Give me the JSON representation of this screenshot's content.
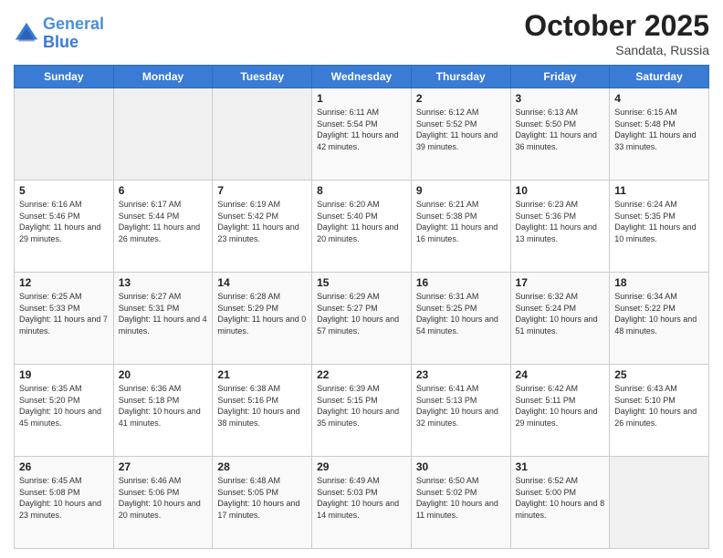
{
  "header": {
    "logo_line1": "General",
    "logo_line2": "Blue",
    "month": "October 2025",
    "location": "Sandata, Russia"
  },
  "weekdays": [
    "Sunday",
    "Monday",
    "Tuesday",
    "Wednesday",
    "Thursday",
    "Friday",
    "Saturday"
  ],
  "weeks": [
    [
      {
        "day": "",
        "sunrise": "",
        "sunset": "",
        "daylight": ""
      },
      {
        "day": "",
        "sunrise": "",
        "sunset": "",
        "daylight": ""
      },
      {
        "day": "",
        "sunrise": "",
        "sunset": "",
        "daylight": ""
      },
      {
        "day": "1",
        "sunrise": "Sunrise: 6:11 AM",
        "sunset": "Sunset: 5:54 PM",
        "daylight": "Daylight: 11 hours and 42 minutes."
      },
      {
        "day": "2",
        "sunrise": "Sunrise: 6:12 AM",
        "sunset": "Sunset: 5:52 PM",
        "daylight": "Daylight: 11 hours and 39 minutes."
      },
      {
        "day": "3",
        "sunrise": "Sunrise: 6:13 AM",
        "sunset": "Sunset: 5:50 PM",
        "daylight": "Daylight: 11 hours and 36 minutes."
      },
      {
        "day": "4",
        "sunrise": "Sunrise: 6:15 AM",
        "sunset": "Sunset: 5:48 PM",
        "daylight": "Daylight: 11 hours and 33 minutes."
      }
    ],
    [
      {
        "day": "5",
        "sunrise": "Sunrise: 6:16 AM",
        "sunset": "Sunset: 5:46 PM",
        "daylight": "Daylight: 11 hours and 29 minutes."
      },
      {
        "day": "6",
        "sunrise": "Sunrise: 6:17 AM",
        "sunset": "Sunset: 5:44 PM",
        "daylight": "Daylight: 11 hours and 26 minutes."
      },
      {
        "day": "7",
        "sunrise": "Sunrise: 6:19 AM",
        "sunset": "Sunset: 5:42 PM",
        "daylight": "Daylight: 11 hours and 23 minutes."
      },
      {
        "day": "8",
        "sunrise": "Sunrise: 6:20 AM",
        "sunset": "Sunset: 5:40 PM",
        "daylight": "Daylight: 11 hours and 20 minutes."
      },
      {
        "day": "9",
        "sunrise": "Sunrise: 6:21 AM",
        "sunset": "Sunset: 5:38 PM",
        "daylight": "Daylight: 11 hours and 16 minutes."
      },
      {
        "day": "10",
        "sunrise": "Sunrise: 6:23 AM",
        "sunset": "Sunset: 5:36 PM",
        "daylight": "Daylight: 11 hours and 13 minutes."
      },
      {
        "day": "11",
        "sunrise": "Sunrise: 6:24 AM",
        "sunset": "Sunset: 5:35 PM",
        "daylight": "Daylight: 11 hours and 10 minutes."
      }
    ],
    [
      {
        "day": "12",
        "sunrise": "Sunrise: 6:25 AM",
        "sunset": "Sunset: 5:33 PM",
        "daylight": "Daylight: 11 hours and 7 minutes."
      },
      {
        "day": "13",
        "sunrise": "Sunrise: 6:27 AM",
        "sunset": "Sunset: 5:31 PM",
        "daylight": "Daylight: 11 hours and 4 minutes."
      },
      {
        "day": "14",
        "sunrise": "Sunrise: 6:28 AM",
        "sunset": "Sunset: 5:29 PM",
        "daylight": "Daylight: 11 hours and 0 minutes."
      },
      {
        "day": "15",
        "sunrise": "Sunrise: 6:29 AM",
        "sunset": "Sunset: 5:27 PM",
        "daylight": "Daylight: 10 hours and 57 minutes."
      },
      {
        "day": "16",
        "sunrise": "Sunrise: 6:31 AM",
        "sunset": "Sunset: 5:25 PM",
        "daylight": "Daylight: 10 hours and 54 minutes."
      },
      {
        "day": "17",
        "sunrise": "Sunrise: 6:32 AM",
        "sunset": "Sunset: 5:24 PM",
        "daylight": "Daylight: 10 hours and 51 minutes."
      },
      {
        "day": "18",
        "sunrise": "Sunrise: 6:34 AM",
        "sunset": "Sunset: 5:22 PM",
        "daylight": "Daylight: 10 hours and 48 minutes."
      }
    ],
    [
      {
        "day": "19",
        "sunrise": "Sunrise: 6:35 AM",
        "sunset": "Sunset: 5:20 PM",
        "daylight": "Daylight: 10 hours and 45 minutes."
      },
      {
        "day": "20",
        "sunrise": "Sunrise: 6:36 AM",
        "sunset": "Sunset: 5:18 PM",
        "daylight": "Daylight: 10 hours and 41 minutes."
      },
      {
        "day": "21",
        "sunrise": "Sunrise: 6:38 AM",
        "sunset": "Sunset: 5:16 PM",
        "daylight": "Daylight: 10 hours and 38 minutes."
      },
      {
        "day": "22",
        "sunrise": "Sunrise: 6:39 AM",
        "sunset": "Sunset: 5:15 PM",
        "daylight": "Daylight: 10 hours and 35 minutes."
      },
      {
        "day": "23",
        "sunrise": "Sunrise: 6:41 AM",
        "sunset": "Sunset: 5:13 PM",
        "daylight": "Daylight: 10 hours and 32 minutes."
      },
      {
        "day": "24",
        "sunrise": "Sunrise: 6:42 AM",
        "sunset": "Sunset: 5:11 PM",
        "daylight": "Daylight: 10 hours and 29 minutes."
      },
      {
        "day": "25",
        "sunrise": "Sunrise: 6:43 AM",
        "sunset": "Sunset: 5:10 PM",
        "daylight": "Daylight: 10 hours and 26 minutes."
      }
    ],
    [
      {
        "day": "26",
        "sunrise": "Sunrise: 6:45 AM",
        "sunset": "Sunset: 5:08 PM",
        "daylight": "Daylight: 10 hours and 23 minutes."
      },
      {
        "day": "27",
        "sunrise": "Sunrise: 6:46 AM",
        "sunset": "Sunset: 5:06 PM",
        "daylight": "Daylight: 10 hours and 20 minutes."
      },
      {
        "day": "28",
        "sunrise": "Sunrise: 6:48 AM",
        "sunset": "Sunset: 5:05 PM",
        "daylight": "Daylight: 10 hours and 17 minutes."
      },
      {
        "day": "29",
        "sunrise": "Sunrise: 6:49 AM",
        "sunset": "Sunset: 5:03 PM",
        "daylight": "Daylight: 10 hours and 14 minutes."
      },
      {
        "day": "30",
        "sunrise": "Sunrise: 6:50 AM",
        "sunset": "Sunset: 5:02 PM",
        "daylight": "Daylight: 10 hours and 11 minutes."
      },
      {
        "day": "31",
        "sunrise": "Sunrise: 6:52 AM",
        "sunset": "Sunset: 5:00 PM",
        "daylight": "Daylight: 10 hours and 8 minutes."
      },
      {
        "day": "",
        "sunrise": "",
        "sunset": "",
        "daylight": ""
      }
    ]
  ]
}
